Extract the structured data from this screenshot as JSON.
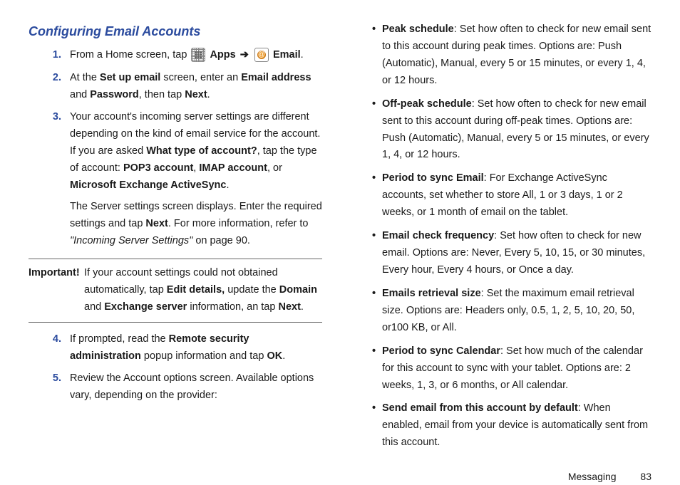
{
  "heading": "Configuring Email Accounts",
  "steps": {
    "s1_a": "From a Home screen, tap ",
    "s1_apps": "Apps",
    "s1_arrow": "➔",
    "s1_email": "Email",
    "s1_end": ".",
    "s2_a": "At the ",
    "s2_b": "Set up email",
    "s2_c": " screen, enter an ",
    "s2_d": "Email address",
    "s2_e": " and ",
    "s2_f": "Password",
    "s2_g": ", then tap ",
    "s2_h": "Next",
    "s2_i": ".",
    "s3_a": "Your account's incoming server settings are different depending on the kind of email service for the account. If you are asked ",
    "s3_b": "What type of account?",
    "s3_c": ", tap the type of account: ",
    "s3_d": "POP3 account",
    "s3_e": ", ",
    "s3_f": "IMAP account",
    "s3_g": ", or ",
    "s3_h": "Microsoft Exchange ActiveSync",
    "s3_i": ".",
    "s3_p2a": "The Server settings screen displays. Enter the required settings and tap ",
    "s3_p2b": "Next",
    "s3_p2c": ". For more information, refer to ",
    "s3_p2d": "\"Incoming Server Settings\"",
    "s3_p2e": "  on page 90.",
    "s4_a": "If prompted, read the ",
    "s4_b": "Remote security administration",
    "s4_c": " popup information and tap ",
    "s4_d": "OK",
    "s4_e": ".",
    "s5": "Review the Account options screen. Available options vary, depending on the provider:"
  },
  "important": {
    "label": "Important!",
    "t1": "If your account settings could not obtained automatically, tap ",
    "t2": "Edit details,",
    "t3": " update the ",
    "t4": "Domain",
    "t5": " and ",
    "t6": "Exchange server",
    "t7": " information, an tap ",
    "t8": "Next",
    "t9": "."
  },
  "bullets": {
    "b1_t": "Peak schedule",
    "b1_d": ": Set how often to check for new email sent to this account during peak times. Options are: Push (Automatic), Manual, every 5 or 15 minutes, or every 1, 4, or 12 hours.",
    "b2_t": "Off-peak schedule",
    "b2_d": ": Set how often to check for new email sent to this account during off-peak times. Options are: Push (Automatic), Manual, every 5 or 15 minutes, or every 1, 4, or 12 hours.",
    "b3_t": "Period to sync Email",
    "b3_d": ": For Exchange ActiveSync accounts, set whether to store All, 1 or 3 days, 1 or 2 weeks, or 1 month of email on the tablet.",
    "b4_t": "Email check frequency",
    "b4_d": ": Set how often to check for new email. Options are: Never, Every 5, 10, 15, or 30 minutes, Every hour, Every 4 hours, or Once a day.",
    "b5_t": "Emails retrieval size",
    "b5_d": ": Set the maximum email retrieval size. Options are: Headers only, 0.5, 1, 2, 5, 10, 20, 50, or100 KB, or All.",
    "b6_t": "Period to sync Calendar",
    "b6_d": ": Set how much of the calendar for this account to sync with your tablet. Options are: 2 weeks, 1, 3, or 6 months, or All calendar.",
    "b7_t": "Send email from this account by default",
    "b7_d": ": When enabled, email from your device is automatically sent from this account."
  },
  "footer": {
    "section": "Messaging",
    "page": "83"
  }
}
